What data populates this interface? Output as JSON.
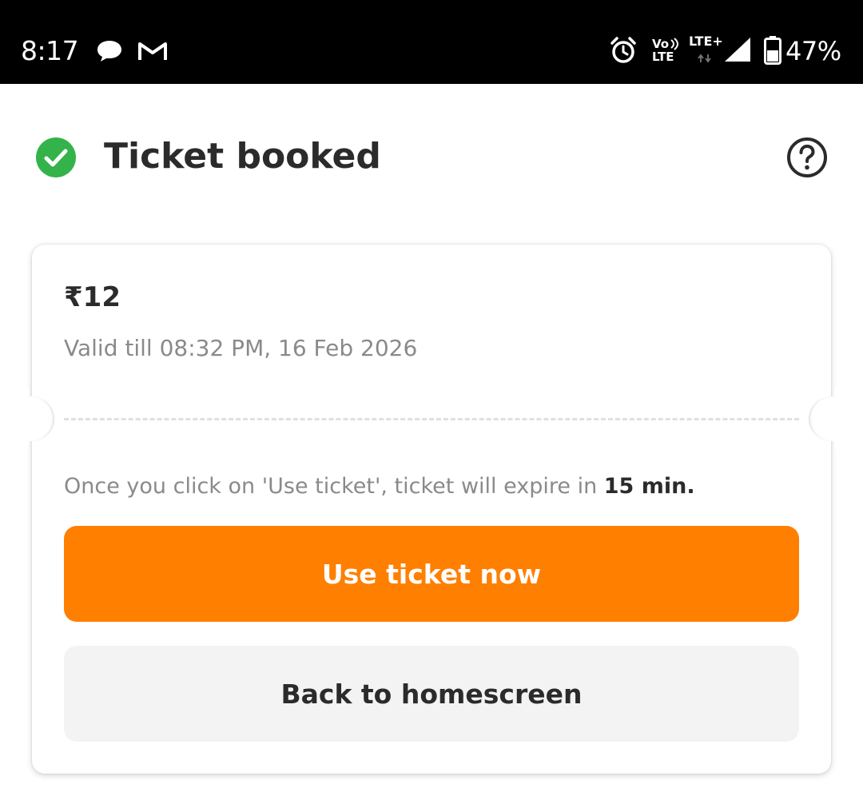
{
  "status_bar": {
    "time": "8:17",
    "battery_percent": "47%",
    "network_label": "LTE+",
    "volte_top": "Vo",
    "volte_bottom": "LTE",
    "icons": [
      "chat-icon",
      "gmail-icon",
      "alarm-icon",
      "volte-icon",
      "lte-plus-icon",
      "signal-icon",
      "battery-icon"
    ]
  },
  "header": {
    "title": "Ticket booked",
    "status_icon": "check-circle-icon",
    "help_icon": "help-circle-icon"
  },
  "ticket": {
    "price": "₹12",
    "validity": "Valid till 08:32 PM, 16 Feb 2026",
    "expiry_note_prefix": "Once you click on 'Use ticket', ticket will expire in ",
    "expiry_note_bold": "15 min."
  },
  "actions": {
    "use_ticket_label": "Use ticket now",
    "back_label": "Back to homescreen"
  },
  "colors": {
    "accent": "#ff7f00",
    "success": "#34b34a",
    "secondary_button_bg": "#f3f3f3",
    "muted_text": "#8a8a8a",
    "status_bar_bg": "#000000"
  }
}
